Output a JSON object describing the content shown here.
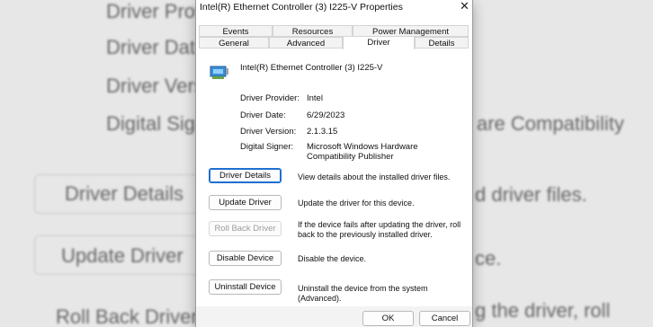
{
  "background": {
    "lines": [
      "Driver Provider:",
      "Driver Date:",
      "Driver Version:",
      "Digital Signer:",
      "are Compatibility",
      "Driver Details",
      "d driver files.",
      "Update Driver",
      "ce.",
      "Roll Back Driver",
      "g the driver, roll"
    ]
  },
  "dialog": {
    "title": "Intel(R) Ethernet Controller (3) I225-V Properties",
    "close_glyph": "✕",
    "tabs_back": [
      "Events",
      "Resources",
      "Power Management"
    ],
    "tabs_front": [
      "General",
      "Advanced",
      "Driver",
      "Details"
    ],
    "active_tab": "Driver",
    "device_icon": "network-adapter-icon",
    "device_name": "Intel(R) Ethernet Controller (3) I225-V",
    "properties": [
      {
        "label": "Driver Provider:",
        "value": "Intel"
      },
      {
        "label": "Driver Date:",
        "value": "6/29/2023"
      },
      {
        "label": "Driver Version:",
        "value": "2.1.3.15"
      },
      {
        "label": "Digital Signer:",
        "value": "Microsoft Windows Hardware Compatibility Publisher"
      }
    ],
    "actions": [
      {
        "label": "Driver Details",
        "description": "View details about the installed driver files.",
        "enabled": true
      },
      {
        "label": "Update Driver",
        "description": "Update the driver for this device.",
        "enabled": true
      },
      {
        "label": "Roll Back Driver",
        "description": "If the device fails after updating the driver, roll back to the previously installed driver.",
        "enabled": false
      },
      {
        "label": "Disable Device",
        "description": "Disable the device.",
        "enabled": true
      },
      {
        "label": "Uninstall Device",
        "description": "Uninstall the device from the system (Advanced).",
        "enabled": true
      }
    ],
    "ok_label": "OK",
    "cancel_label": "Cancel"
  },
  "colors": {
    "focus_border": "#1f6fd1",
    "disabled_text": "#9c9c9c"
  }
}
